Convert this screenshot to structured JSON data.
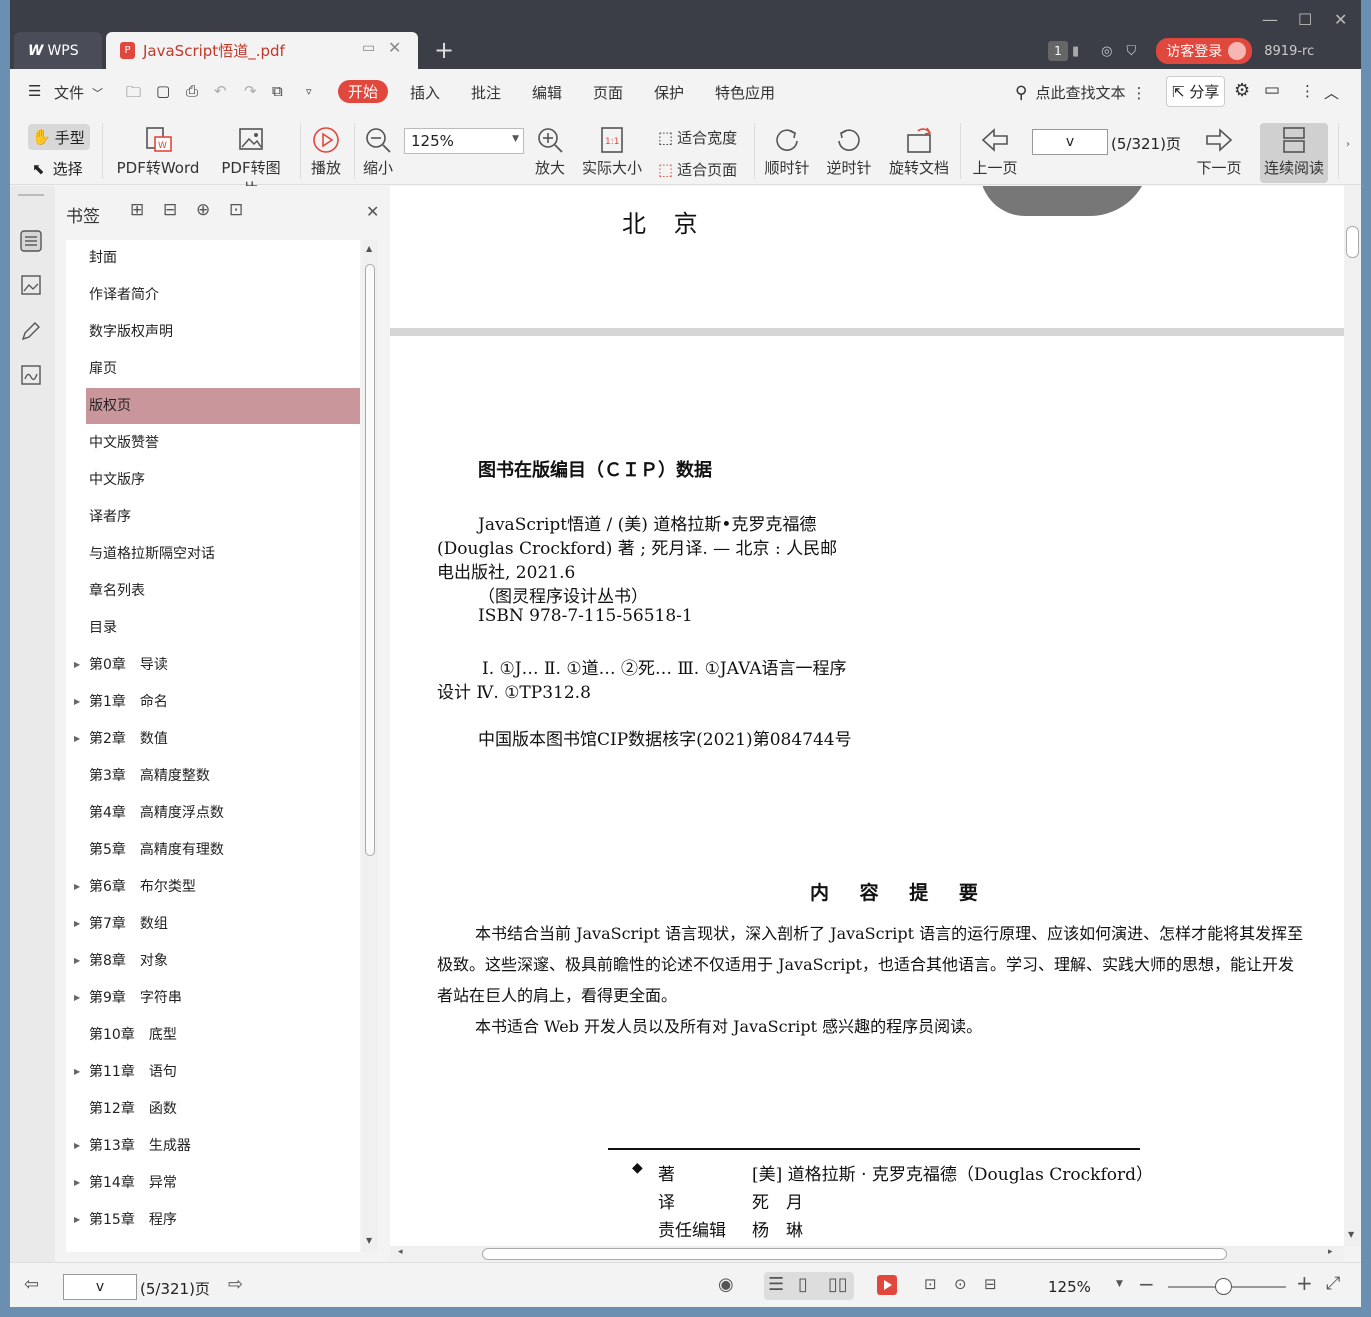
{
  "app": {
    "brand_tab": "WPS",
    "doc_tab": "JavaScript悟道_.pdf",
    "login_button": "访客登录",
    "version": "8919-rc",
    "badge_count": "1"
  },
  "menu": {
    "file": "文件",
    "items": [
      "开始",
      "插入",
      "批注",
      "编辑",
      "页面",
      "保护",
      "特色应用"
    ],
    "search": "点此查找文本",
    "share": "分享"
  },
  "toolbar": {
    "hand": "手型",
    "select": "选择",
    "pdf_to_word": "PDF转Word",
    "pdf_to_image": "PDF转图片",
    "play": "播放",
    "zoom_out": "缩小",
    "zoom_value": "125%",
    "zoom_in": "放大",
    "actual_size": "实际大小",
    "fit_width": "适合宽度",
    "fit_page": "适合页面",
    "clockwise": "顺时针",
    "counter_clockwise": "逆时针",
    "rotate_doc": "旋转文档",
    "prev_page": "上一页",
    "page_input": "v",
    "page_count": "(5/321)页",
    "next_page": "下一页",
    "continuous_read": "连续阅读"
  },
  "bookmarks": {
    "title": "书签",
    "items": [
      {
        "label": "封面",
        "expandable": false
      },
      {
        "label": "作译者简介",
        "expandable": false
      },
      {
        "label": "数字版权声明",
        "expandable": false
      },
      {
        "label": "扉页",
        "expandable": false
      },
      {
        "label": "版权页",
        "expandable": false,
        "active": true
      },
      {
        "label": "中文版赞誉",
        "expandable": false
      },
      {
        "label": "中文版序",
        "expandable": false
      },
      {
        "label": "译者序",
        "expandable": false
      },
      {
        "label": "与道格拉斯隔空对话",
        "expandable": false
      },
      {
        "label": "章名列表",
        "expandable": false
      },
      {
        "label": "目录",
        "expandable": false
      },
      {
        "label": "第0章　导读",
        "expandable": true
      },
      {
        "label": "第1章　命名",
        "expandable": true
      },
      {
        "label": "第2章　数值",
        "expandable": true
      },
      {
        "label": "第3章　高精度整数",
        "expandable": false
      },
      {
        "label": "第4章　高精度浮点数",
        "expandable": false
      },
      {
        "label": "第5章　高精度有理数",
        "expandable": false
      },
      {
        "label": "第6章　布尔类型",
        "expandable": true
      },
      {
        "label": "第7章　数组",
        "expandable": true
      },
      {
        "label": "第8章　对象",
        "expandable": true
      },
      {
        "label": "第9章　字符串",
        "expandable": true
      },
      {
        "label": "第10章　底型",
        "expandable": false
      },
      {
        "label": "第11章　语句",
        "expandable": true
      },
      {
        "label": "第12章　函数",
        "expandable": false
      },
      {
        "label": "第13章　生成器",
        "expandable": true
      },
      {
        "label": "第14章　异常",
        "expandable": true
      },
      {
        "label": "第15章　程序",
        "expandable": true
      }
    ]
  },
  "document": {
    "publisher_city": "北 京",
    "cip_title": "图书在版编目（ＣＩＰ）数据",
    "cip_lines": [
      "JavaScript悟道 / (美) 道格拉斯•克罗克福德",
      "(Douglas Crockford) 著 ; 死月译. — 北京 : 人民邮",
      "电出版社, 2021.6",
      "（图灵程序设计丛书）",
      "ISBN 978-7-115-56518-1",
      "Ⅰ. ①J… Ⅱ. ①道… ②死… Ⅲ. ①JAVA语言一程序",
      "设计 Ⅳ. ①TP312.8",
      "中国版本图书馆CIP数据核字(2021)第084744号"
    ],
    "summary_title": "内 容 提 要",
    "summary_p1": "本书结合当前 JavaScript 语言现状，深入剖析了 JavaScript 语言的运行原理、应该如何演进、怎样才能将其发挥至极致。这些深邃、极具前瞻性的论述不仅适用于 JavaScript，也适合其他语言。学习、理解、实践大师的思想，能让开发者站在巨人的肩上，看得更全面。",
    "summary_p2": "本书适合 Web 开发人员以及所有对 JavaScript 感兴趣的程序员阅读。",
    "credits": [
      {
        "role": "著",
        "name": "[美] 道格拉斯 · 克罗克福德（Douglas Crockford）"
      },
      {
        "role": "译",
        "name": "死　月"
      },
      {
        "role": "责任编辑",
        "name": "杨　琳"
      }
    ]
  },
  "status": {
    "page_input": "v",
    "page_count": "(5/321)页",
    "zoom": "125%",
    "play_color": "#e0483e"
  },
  "colors": {
    "accent": "#e0483e",
    "bookmark_active": "#c9969c",
    "titlebar": "#3b3d47"
  }
}
